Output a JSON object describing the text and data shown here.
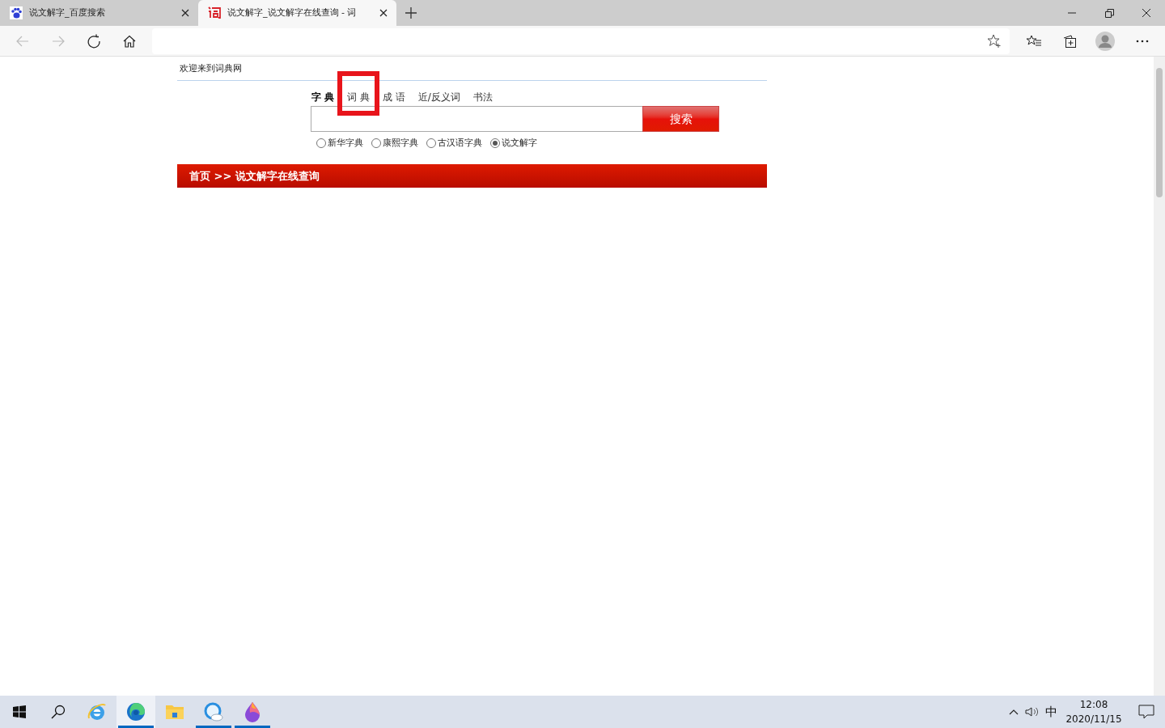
{
  "browser_tabs": [
    {
      "title": "说文解字_百度搜索",
      "selected": false
    },
    {
      "title": "说文解字_说文解字在线查询 - 词",
      "selected": true
    }
  ],
  "page": {
    "welcome": "欢迎来到词典网",
    "nav": [
      {
        "label": "字 典",
        "selected": true
      },
      {
        "label": "词 典",
        "selected": false
      },
      {
        "label": "成 语",
        "selected": false
      },
      {
        "label": "近/反义词",
        "selected": false
      },
      {
        "label": "书法",
        "selected": false
      }
    ],
    "search_button": "搜索",
    "options": [
      {
        "label": "新华字典",
        "selected": false
      },
      {
        "label": "康熙字典",
        "selected": false
      },
      {
        "label": "古汉语字典",
        "selected": false
      },
      {
        "label": "说文解字",
        "selected": true
      }
    ],
    "breadcrumb": "首页 >> 说文解字在线查询"
  },
  "taskbar": {
    "apps": [
      {
        "kind": "ie",
        "active": false,
        "running": false
      },
      {
        "kind": "edge",
        "active": true,
        "running": true
      },
      {
        "kind": "folder",
        "active": false,
        "running": false
      },
      {
        "kind": "search-cloud",
        "active": false,
        "running": true
      },
      {
        "kind": "drop",
        "active": false,
        "running": true
      }
    ],
    "ime": "中",
    "time": "12:08",
    "date": "2020/11/15"
  }
}
